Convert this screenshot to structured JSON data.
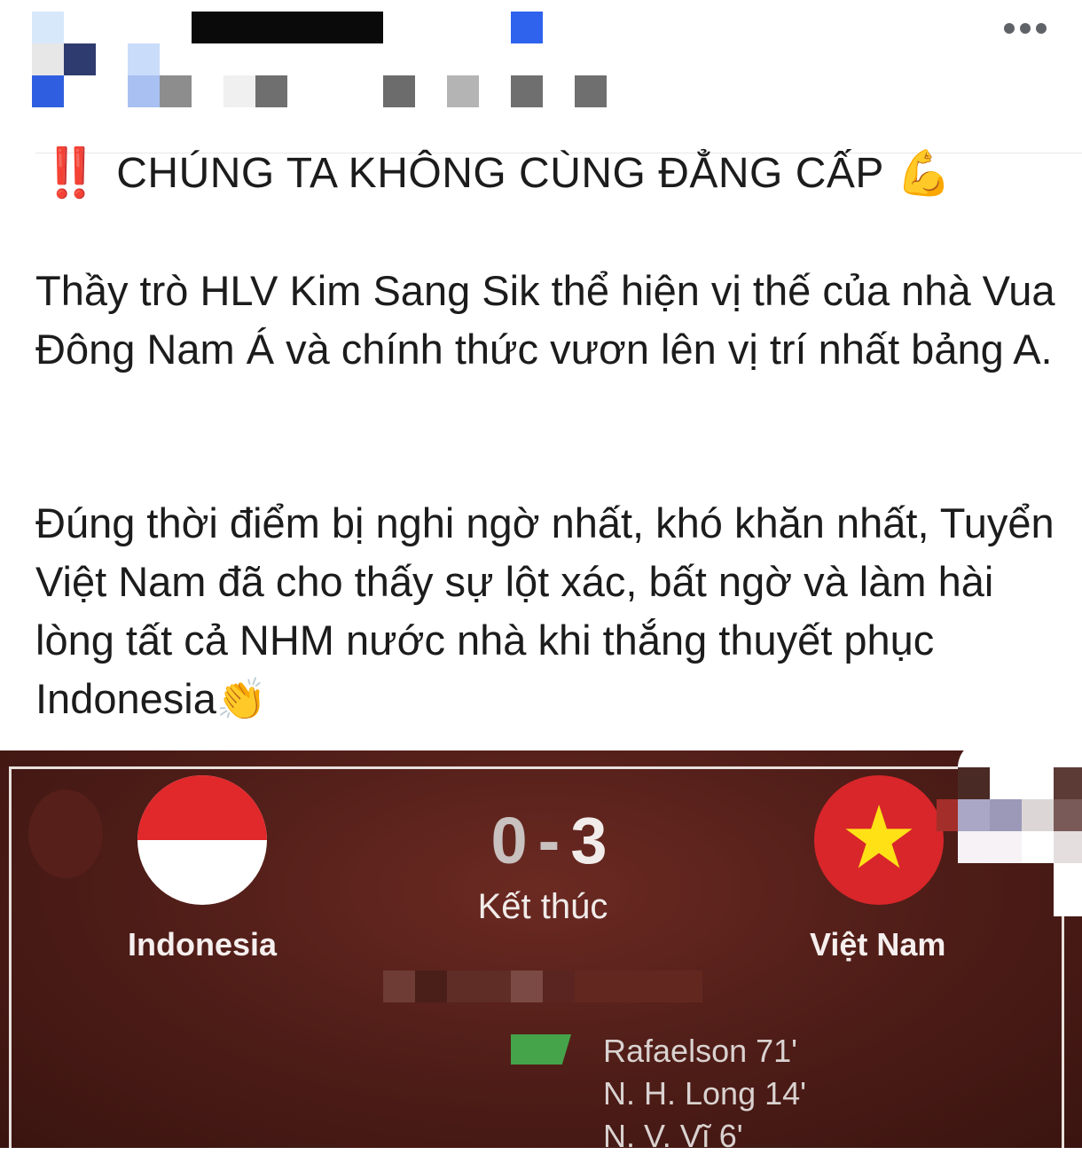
{
  "post": {
    "more_label": "More options",
    "headline_marks": "‼️",
    "headline": "CHÚNG TA KHÔNG CÙNG ĐẲNG CẤP",
    "headline_emoji": "💪",
    "paragraph1": "Thầy trò HLV Kim Sang Sik thể hiện vị thế của nhà Vua Đông Nam Á và chính thức vươn lên vị trí nhất bảng A.",
    "paragraph2": "Đúng thời điểm bị nghi ngờ nhất, khó khăn nhất, Tuyển Việt Nam đã cho thấy sự lột xác, bất ngờ và làm hài lòng tất cả NHM nước nhà khi thắng thuyết phục Indonesia",
    "paragraph2_emoji": "👏"
  },
  "match": {
    "home_team": "Indonesia",
    "away_team": "Việt Nam",
    "home_score": "0",
    "separator": "-",
    "away_score": "3",
    "status": "Kết thúc",
    "scorers": [
      "Rafaelson 71'",
      "N. H. Long 14'",
      "N. V. Vĩ 6'"
    ]
  },
  "colors": {
    "card_bg": "#4d1c17",
    "goal_green": "#45a34a",
    "alert_red": "#e0262b"
  }
}
